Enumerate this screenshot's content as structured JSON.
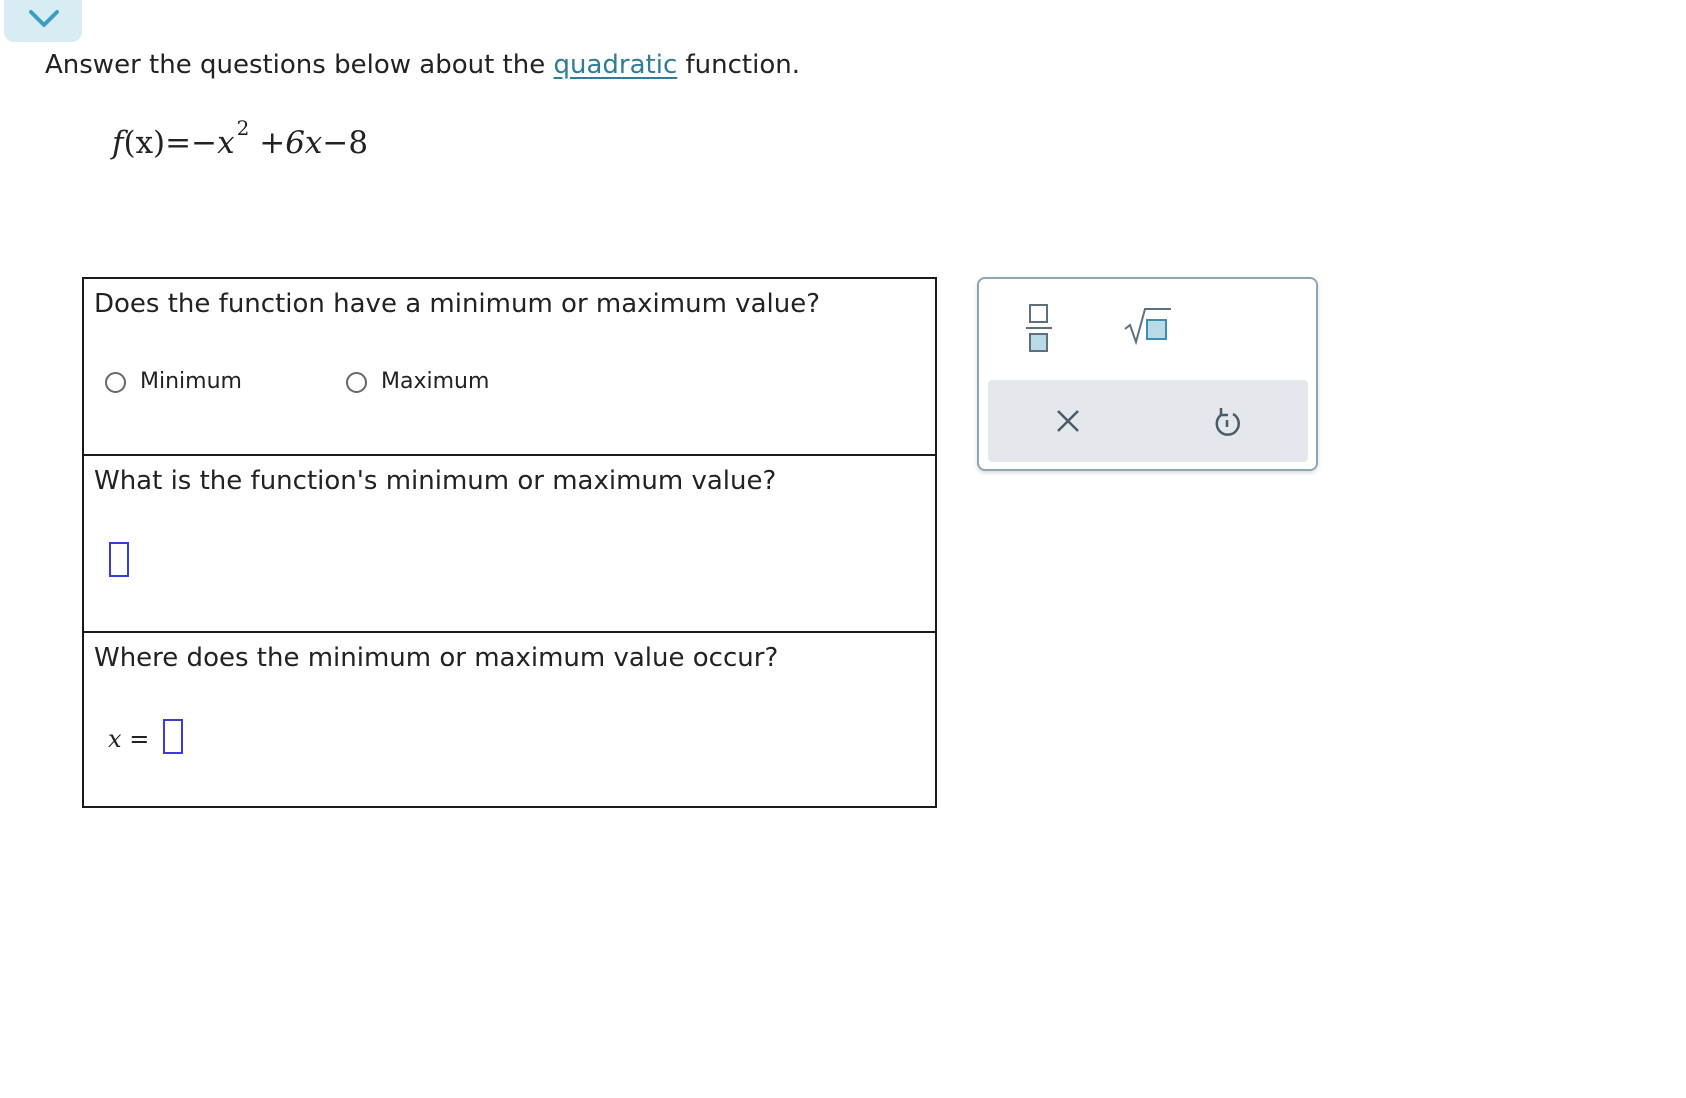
{
  "header": {
    "collapse_icon": "chevron-down-icon",
    "accent_color": "#2f7d95"
  },
  "instruction": {
    "prefix": "Answer the questions below about the",
    "link": "quadratic",
    "suffix": "function."
  },
  "formula": {
    "lhs": "f",
    "arg": "(x)",
    "equals": "=",
    "neg": "−",
    "term1_var": "x",
    "term1_exp": "2",
    "plus": "+",
    "term2": "6x",
    "minus": "−",
    "constant": "8"
  },
  "questions": [
    {
      "text": "Does the function have a minimum or maximum value?",
      "options": [
        "Minimum",
        "Maximum"
      ]
    },
    {
      "text": "What is the function's minimum or maximum value?"
    },
    {
      "text": "Where does the minimum or maximum value occur?",
      "variable": "x",
      "equals": "="
    }
  ],
  "palette": {
    "tools": [
      "fraction-icon",
      "square-root-icon"
    ],
    "actions": [
      "clear-icon",
      "undo-icon"
    ],
    "box_color": "#3a8fb0"
  }
}
